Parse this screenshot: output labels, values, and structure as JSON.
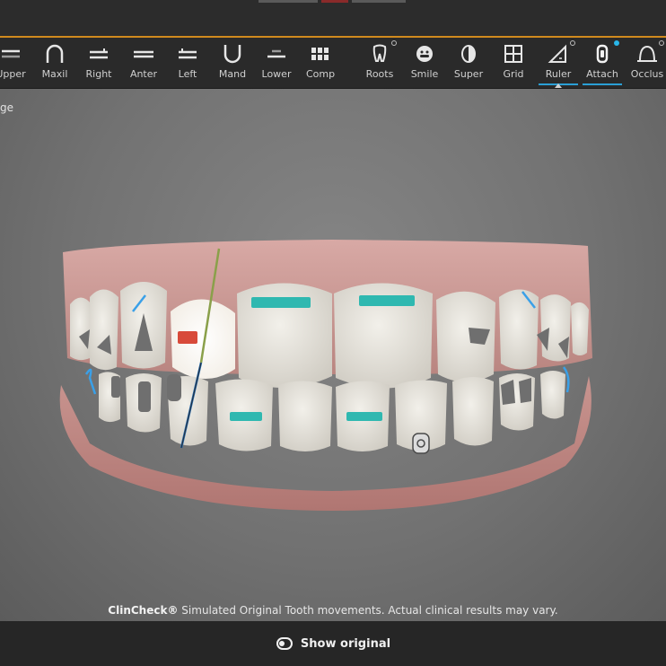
{
  "toolbar": {
    "tools": [
      {
        "key": "upper",
        "label": "Upper",
        "icon": "upper-arch-icon"
      },
      {
        "key": "max",
        "label": "Maxil",
        "icon": "arch-icon"
      },
      {
        "key": "right",
        "label": "Right",
        "icon": "right-view-icon"
      },
      {
        "key": "anterior",
        "label": "Anter",
        "icon": "anterior-view-icon"
      },
      {
        "key": "left",
        "label": "Left",
        "icon": "left-view-icon"
      },
      {
        "key": "mand",
        "label": "Mand",
        "icon": "mandibular-arch-icon"
      },
      {
        "key": "lower",
        "label": "Lower",
        "icon": "lower-arch-icon"
      },
      {
        "key": "comp",
        "label": "Comp",
        "icon": "compare-grid-icon"
      },
      {
        "key": "roots",
        "label": "Roots",
        "icon": "tooth-roots-icon"
      },
      {
        "key": "smile",
        "label": "Smile",
        "icon": "smile-icon"
      },
      {
        "key": "super",
        "label": "Super",
        "icon": "superimpose-icon"
      },
      {
        "key": "grid",
        "label": "Grid",
        "icon": "grid-icon"
      },
      {
        "key": "ruler",
        "label": "Ruler",
        "icon": "ruler-icon"
      },
      {
        "key": "attach",
        "label": "Attach",
        "icon": "attachment-icon"
      },
      {
        "key": "occlusion",
        "label": "Occlus",
        "icon": "occlusion-icon"
      }
    ]
  },
  "viewport": {
    "view_label": "ge",
    "disclaimer_brand": "ClinCheck®",
    "disclaimer_text": "Simulated Original Tooth movements. Actual clinical results may vary."
  },
  "bottom": {
    "show_original_label": "Show original"
  },
  "colors": {
    "accent_orange": "#d08a1e",
    "active_blue": "#2a9fd6",
    "attachment_teal": "#2fb8b0",
    "selected_attachment_red": "#d84a3a"
  }
}
